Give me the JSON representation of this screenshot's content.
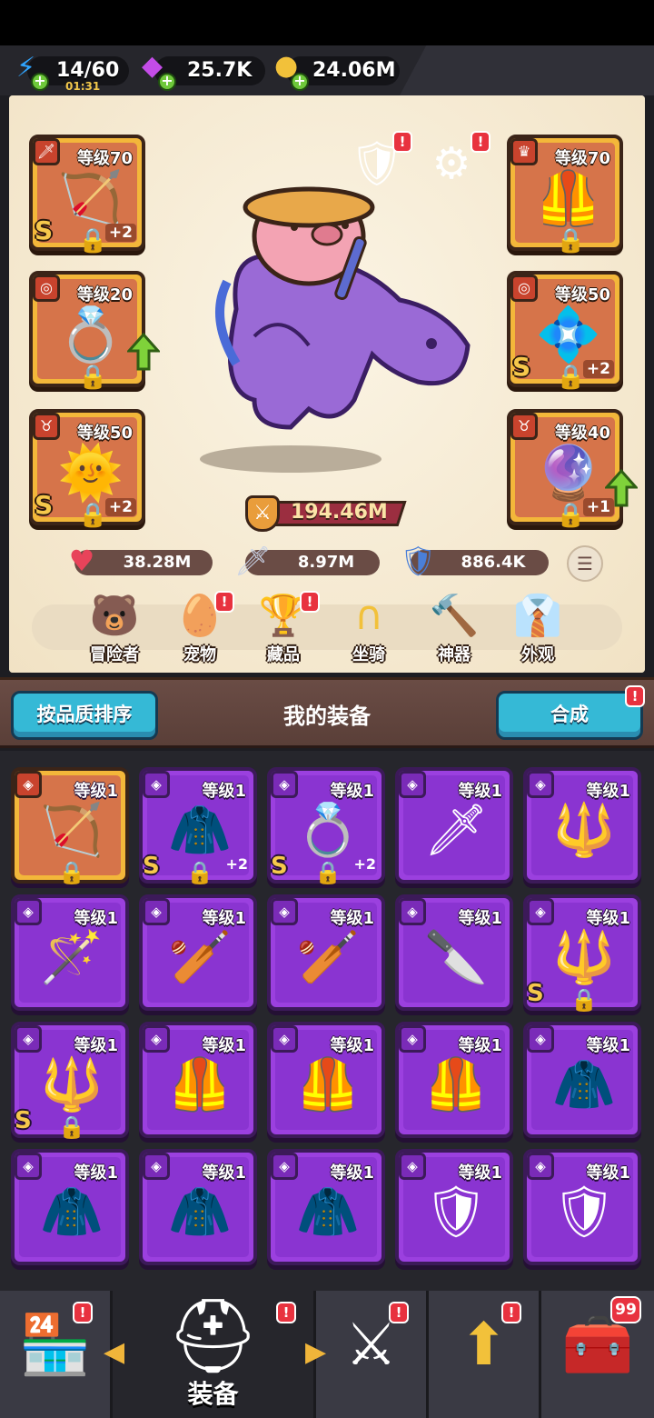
{
  "resources": {
    "energy": {
      "value": "14/60",
      "timer": "01:31",
      "icon": "lightning-icon"
    },
    "gems": {
      "value": "25.7K",
      "icon": "gem-icon"
    },
    "gold": {
      "value": "24.06M",
      "icon": "coin-icon"
    }
  },
  "equipped": {
    "weapon": {
      "level": "等级70",
      "grade": "S",
      "plus": "+2",
      "icon": "crossbow-icon"
    },
    "armor": {
      "level": "等级70",
      "icon": "armor-icon"
    },
    "ring": {
      "level": "等级20",
      "icon": "ring-icon"
    },
    "gauntlet": {
      "level": "等级50",
      "grade": "S",
      "plus": "+2",
      "icon": "gauntlet-icon"
    },
    "necklace": {
      "level": "等级50",
      "grade": "S",
      "plus": "+2",
      "icon": "amulet-icon"
    },
    "orb": {
      "level": "等级40",
      "plus": "+1",
      "icon": "orb-icon"
    }
  },
  "hero": {
    "power": "194.46M",
    "hp": "38.28M",
    "attack": "8.97M",
    "defense": "886.4K",
    "alert": "!"
  },
  "tabs": [
    {
      "label": "冒险者",
      "icon": "capybara-icon",
      "alert": ""
    },
    {
      "label": "宠物",
      "icon": "egg-icon",
      "alert": "!"
    },
    {
      "label": "藏品",
      "icon": "trophy-icon",
      "alert": "!"
    },
    {
      "label": "坐骑",
      "icon": "horseshoe-icon",
      "alert": ""
    },
    {
      "label": "神器",
      "icon": "hammer-icon",
      "alert": ""
    },
    {
      "label": "外观",
      "icon": "outfit-icon",
      "alert": ""
    }
  ],
  "gear": {
    "sort_label": "按品质排序",
    "title": "我的装备",
    "merge_label": "合成",
    "merge_alert": "!",
    "items": [
      {
        "level": "等级1",
        "gold": true,
        "grade": "",
        "plus": "",
        "lock": true,
        "icon": "bow-icon"
      },
      {
        "level": "等级1",
        "gold": false,
        "grade": "S",
        "plus": "+2",
        "lock": true,
        "icon": "cloak-icon"
      },
      {
        "level": "等级1",
        "gold": false,
        "grade": "S",
        "plus": "+2",
        "lock": true,
        "icon": "ring-icon"
      },
      {
        "level": "等级1",
        "gold": false,
        "grade": "",
        "plus": "",
        "lock": false,
        "icon": "sword-icon"
      },
      {
        "level": "等级1",
        "gold": false,
        "grade": "",
        "plus": "",
        "lock": false,
        "icon": "spear-icon"
      },
      {
        "level": "等级1",
        "gold": false,
        "grade": "",
        "plus": "",
        "lock": false,
        "icon": "staff-icon"
      },
      {
        "level": "等级1",
        "gold": false,
        "grade": "",
        "plus": "",
        "lock": false,
        "icon": "club-icon"
      },
      {
        "level": "等级1",
        "gold": false,
        "grade": "",
        "plus": "",
        "lock": false,
        "icon": "club-icon"
      },
      {
        "level": "等级1",
        "gold": false,
        "grade": "",
        "plus": "",
        "lock": false,
        "icon": "crystal-sword-icon"
      },
      {
        "level": "等级1",
        "gold": false,
        "grade": "S",
        "plus": "",
        "lock": true,
        "icon": "spear-icon"
      },
      {
        "level": "等级1",
        "gold": false,
        "grade": "S",
        "plus": "",
        "lock": true,
        "icon": "spear-icon"
      },
      {
        "level": "等级1",
        "gold": false,
        "grade": "",
        "plus": "",
        "lock": false,
        "icon": "tunic-icon"
      },
      {
        "level": "等级1",
        "gold": false,
        "grade": "",
        "plus": "",
        "lock": false,
        "icon": "tunic-icon"
      },
      {
        "level": "等级1",
        "gold": false,
        "grade": "",
        "plus": "",
        "lock": false,
        "icon": "tunic-icon"
      },
      {
        "level": "等级1",
        "gold": false,
        "grade": "",
        "plus": "",
        "lock": false,
        "icon": "fur-armor-icon"
      },
      {
        "level": "等级1",
        "gold": false,
        "grade": "",
        "plus": "",
        "lock": false,
        "icon": "fur-armor-icon"
      },
      {
        "level": "等级1",
        "gold": false,
        "grade": "",
        "plus": "",
        "lock": false,
        "icon": "fur-armor-icon"
      },
      {
        "level": "等级1",
        "gold": false,
        "grade": "",
        "plus": "",
        "lock": false,
        "icon": "fur-armor-icon"
      },
      {
        "level": "等级1",
        "gold": false,
        "grade": "",
        "plus": "",
        "lock": false,
        "icon": "plate-armor-icon"
      },
      {
        "level": "等级1",
        "gold": false,
        "grade": "",
        "plus": "",
        "lock": false,
        "icon": "plate-armor-icon"
      }
    ]
  },
  "bottom_nav": [
    {
      "label": "",
      "icon": "shop-icon",
      "alert": "!"
    },
    {
      "label": "装备",
      "icon": "helmet-icon",
      "alert": "!"
    },
    {
      "label": "",
      "icon": "crossed-swords-icon",
      "alert": "!"
    },
    {
      "label": "",
      "icon": "upgrade-icon",
      "alert": "!"
    },
    {
      "label": "",
      "icon": "chest-icon",
      "alert": "99"
    }
  ],
  "colors": {
    "epic": "#9b40df",
    "legendary": "#f3b73a",
    "accent_cyan": "#35b9d6",
    "alert_red": "#e8323f"
  }
}
